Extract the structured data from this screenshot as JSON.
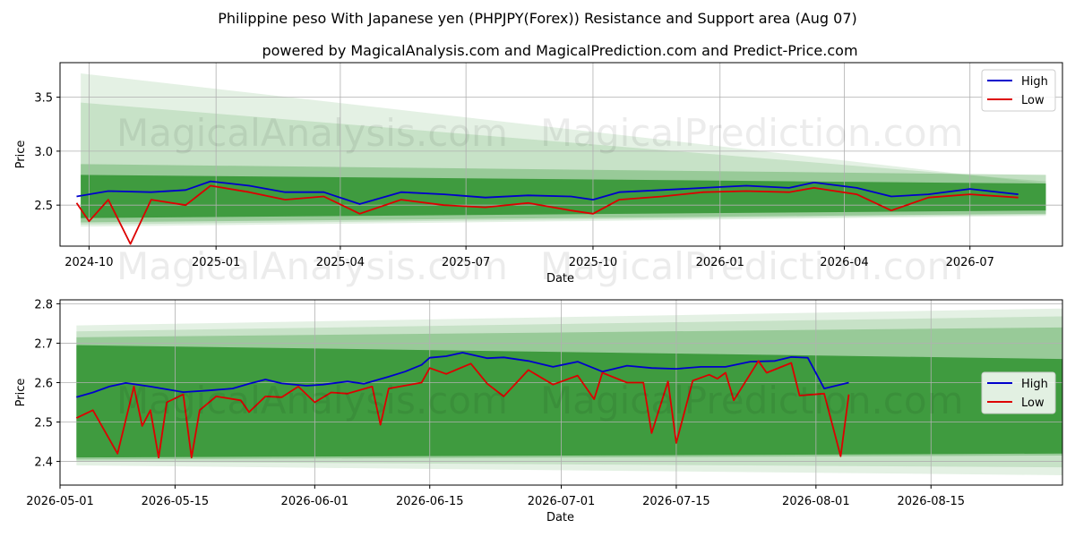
{
  "title": "Philippine peso With Japanese yen (PHPJPY(Forex)) Resistance and Support area (Aug 07)",
  "subtitle": "powered by MagicalAnalysis.com and MagicalPrediction.com and Predict-Price.com",
  "watermarks": [
    "MagicalAnalysis.com",
    "MagicalPrediction.com"
  ],
  "colors": {
    "high": "#0000cc",
    "low": "#dd0000",
    "band": "#228b22"
  },
  "chart_data": [
    {
      "type": "line",
      "xlabel": "Date",
      "ylabel": "Price",
      "ylim": [
        2.12,
        3.82
      ],
      "xlim": [
        "2024-09-10",
        "2026-09-06"
      ],
      "xtick_labels": [
        "2024-10",
        "2025-01",
        "2025-04",
        "2025-07",
        "2025-10",
        "2026-01",
        "2026-04",
        "2026-07"
      ],
      "ytick_labels": [
        "2.5",
        "3.0",
        "3.5"
      ],
      "grid": true,
      "legend": "top-right",
      "series": [
        {
          "name": "High",
          "x": [
            "2024-09-22",
            "2024-10-15",
            "2024-11-15",
            "2024-12-10",
            "2024-12-28",
            "2025-01-25",
            "2025-02-20",
            "2025-03-20",
            "2025-04-15",
            "2025-05-15",
            "2025-06-15",
            "2025-07-15",
            "2025-08-15",
            "2025-09-15",
            "2025-10-01",
            "2025-10-20",
            "2025-11-20",
            "2025-12-20",
            "2026-01-20",
            "2026-02-20",
            "2026-03-10",
            "2026-04-10",
            "2026-05-05",
            "2026-06-01",
            "2026-07-01",
            "2026-08-05"
          ],
          "values": [
            2.58,
            2.63,
            2.62,
            2.64,
            2.72,
            2.68,
            2.62,
            2.62,
            2.51,
            2.62,
            2.6,
            2.57,
            2.59,
            2.58,
            2.55,
            2.62,
            2.64,
            2.66,
            2.68,
            2.66,
            2.71,
            2.66,
            2.58,
            2.6,
            2.65,
            2.6
          ]
        },
        {
          "name": "Low",
          "x": [
            "2024-09-22",
            "2024-10-01",
            "2024-10-15",
            "2024-10-31",
            "2024-11-15",
            "2024-12-10",
            "2024-12-28",
            "2025-01-25",
            "2025-02-20",
            "2025-03-20",
            "2025-04-15",
            "2025-05-15",
            "2025-06-15",
            "2025-07-15",
            "2025-08-15",
            "2025-09-15",
            "2025-10-01",
            "2025-10-20",
            "2025-11-20",
            "2025-12-20",
            "2026-01-20",
            "2026-02-20",
            "2026-03-10",
            "2026-04-10",
            "2026-05-05",
            "2026-06-01",
            "2026-07-01",
            "2026-08-05"
          ],
          "values": [
            2.52,
            2.35,
            2.55,
            2.14,
            2.55,
            2.5,
            2.68,
            2.62,
            2.55,
            2.58,
            2.42,
            2.55,
            2.5,
            2.48,
            2.52,
            2.45,
            2.42,
            2.55,
            2.58,
            2.62,
            2.63,
            2.62,
            2.66,
            2.6,
            2.45,
            2.57,
            2.6,
            2.57
          ]
        }
      ],
      "bands": [
        {
          "from": "2024-09-25",
          "to": "2026-08-25",
          "upper": [
            3.72,
            2.7
          ],
          "lower": [
            2.3,
            2.4
          ]
        },
        {
          "from": "2024-09-25",
          "to": "2026-08-25",
          "upper": [
            3.45,
            2.72
          ],
          "lower": [
            2.32,
            2.41
          ]
        },
        {
          "from": "2024-09-25",
          "to": "2026-08-25",
          "upper": [
            2.88,
            2.78
          ],
          "lower": [
            2.34,
            2.42
          ]
        },
        {
          "from": "2024-09-25",
          "to": "2026-08-25",
          "upper": [
            2.78,
            2.7
          ],
          "lower": [
            2.38,
            2.45
          ]
        }
      ]
    },
    {
      "type": "line",
      "xlabel": "Date",
      "ylabel": "Price",
      "ylim": [
        2.34,
        2.81
      ],
      "xlim": [
        "2026-05-01",
        "2026-08-31"
      ],
      "xtick_labels": [
        "2026-05-01",
        "2026-05-15",
        "2026-06-01",
        "2026-06-15",
        "2026-07-01",
        "2026-07-15",
        "2026-08-01",
        "2026-08-15"
      ],
      "ytick_labels": [
        "2.4",
        "2.5",
        "2.6",
        "2.7",
        "2.8"
      ],
      "grid": true,
      "legend": "center-right",
      "series": [
        {
          "name": "High",
          "x": [
            "2026-05-03",
            "2026-05-05",
            "2026-05-07",
            "2026-05-09",
            "2026-05-12",
            "2026-05-14",
            "2026-05-16",
            "2026-05-19",
            "2026-05-22",
            "2026-05-24",
            "2026-05-26",
            "2026-05-28",
            "2026-05-31",
            "2026-06-02",
            "2026-06-05",
            "2026-06-07",
            "2026-06-10",
            "2026-06-12",
            "2026-06-14",
            "2026-06-15",
            "2026-06-17",
            "2026-06-19",
            "2026-06-22",
            "2026-06-24",
            "2026-06-27",
            "2026-06-30",
            "2026-07-03",
            "2026-07-06",
            "2026-07-09",
            "2026-07-12",
            "2026-07-15",
            "2026-07-18",
            "2026-07-21",
            "2026-07-24",
            "2026-07-27",
            "2026-07-29",
            "2026-07-31",
            "2026-08-02",
            "2026-08-05"
          ],
          "values": [
            2.563,
            2.575,
            2.59,
            2.599,
            2.59,
            2.583,
            2.576,
            2.58,
            2.585,
            2.597,
            2.608,
            2.598,
            2.592,
            2.595,
            2.603,
            2.597,
            2.615,
            2.628,
            2.645,
            2.663,
            2.667,
            2.676,
            2.662,
            2.664,
            2.655,
            2.64,
            2.653,
            2.628,
            2.643,
            2.637,
            2.635,
            2.64,
            2.64,
            2.653,
            2.655,
            2.665,
            2.663,
            2.585,
            2.6
          ]
        },
        {
          "name": "Low",
          "x": [
            "2026-05-03",
            "2026-05-05",
            "2026-05-08",
            "2026-05-10",
            "2026-05-11",
            "2026-05-12",
            "2026-05-13",
            "2026-05-14",
            "2026-05-16",
            "2026-05-17",
            "2026-05-18",
            "2026-05-20",
            "2026-05-23",
            "2026-05-24",
            "2026-05-26",
            "2026-05-28",
            "2026-05-30",
            "2026-06-01",
            "2026-06-03",
            "2026-06-05",
            "2026-06-08",
            "2026-06-09",
            "2026-06-10",
            "2026-06-14",
            "2026-06-15",
            "2026-06-17",
            "2026-06-20",
            "2026-06-22",
            "2026-06-24",
            "2026-06-27",
            "2026-06-30",
            "2026-07-03",
            "2026-07-05",
            "2026-07-06",
            "2026-07-09",
            "2026-07-11",
            "2026-07-12",
            "2026-07-14",
            "2026-07-15",
            "2026-07-17",
            "2026-07-19",
            "2026-07-20",
            "2026-07-21",
            "2026-07-22",
            "2026-07-25",
            "2026-07-26",
            "2026-07-29",
            "2026-07-30",
            "2026-08-02",
            "2026-08-04",
            "2026-08-05"
          ],
          "values": [
            2.51,
            2.53,
            2.42,
            2.59,
            2.49,
            2.53,
            2.41,
            2.55,
            2.57,
            2.41,
            2.53,
            2.565,
            2.555,
            2.525,
            2.565,
            2.563,
            2.59,
            2.55,
            2.575,
            2.572,
            2.59,
            2.493,
            2.585,
            2.6,
            2.637,
            2.622,
            2.648,
            2.597,
            2.565,
            2.632,
            2.595,
            2.618,
            2.558,
            2.625,
            2.6,
            2.6,
            2.472,
            2.603,
            2.447,
            2.605,
            2.62,
            2.61,
            2.625,
            2.555,
            2.655,
            2.625,
            2.65,
            2.567,
            2.572,
            2.413,
            2.57
          ]
        }
      ],
      "bands": [
        {
          "from": "2026-05-03",
          "to": "2026-08-31",
          "upper": [
            2.745,
            2.788
          ],
          "lower": [
            2.39,
            2.365
          ]
        },
        {
          "from": "2026-05-03",
          "to": "2026-08-31",
          "upper": [
            2.73,
            2.768
          ],
          "lower": [
            2.4,
            2.385
          ]
        },
        {
          "from": "2026-05-03",
          "to": "2026-08-31",
          "upper": [
            2.715,
            2.74
          ],
          "lower": [
            2.405,
            2.415
          ]
        },
        {
          "from": "2026-05-03",
          "to": "2026-08-31",
          "upper": [
            2.695,
            2.66
          ],
          "lower": [
            2.41,
            2.42
          ]
        }
      ]
    }
  ]
}
